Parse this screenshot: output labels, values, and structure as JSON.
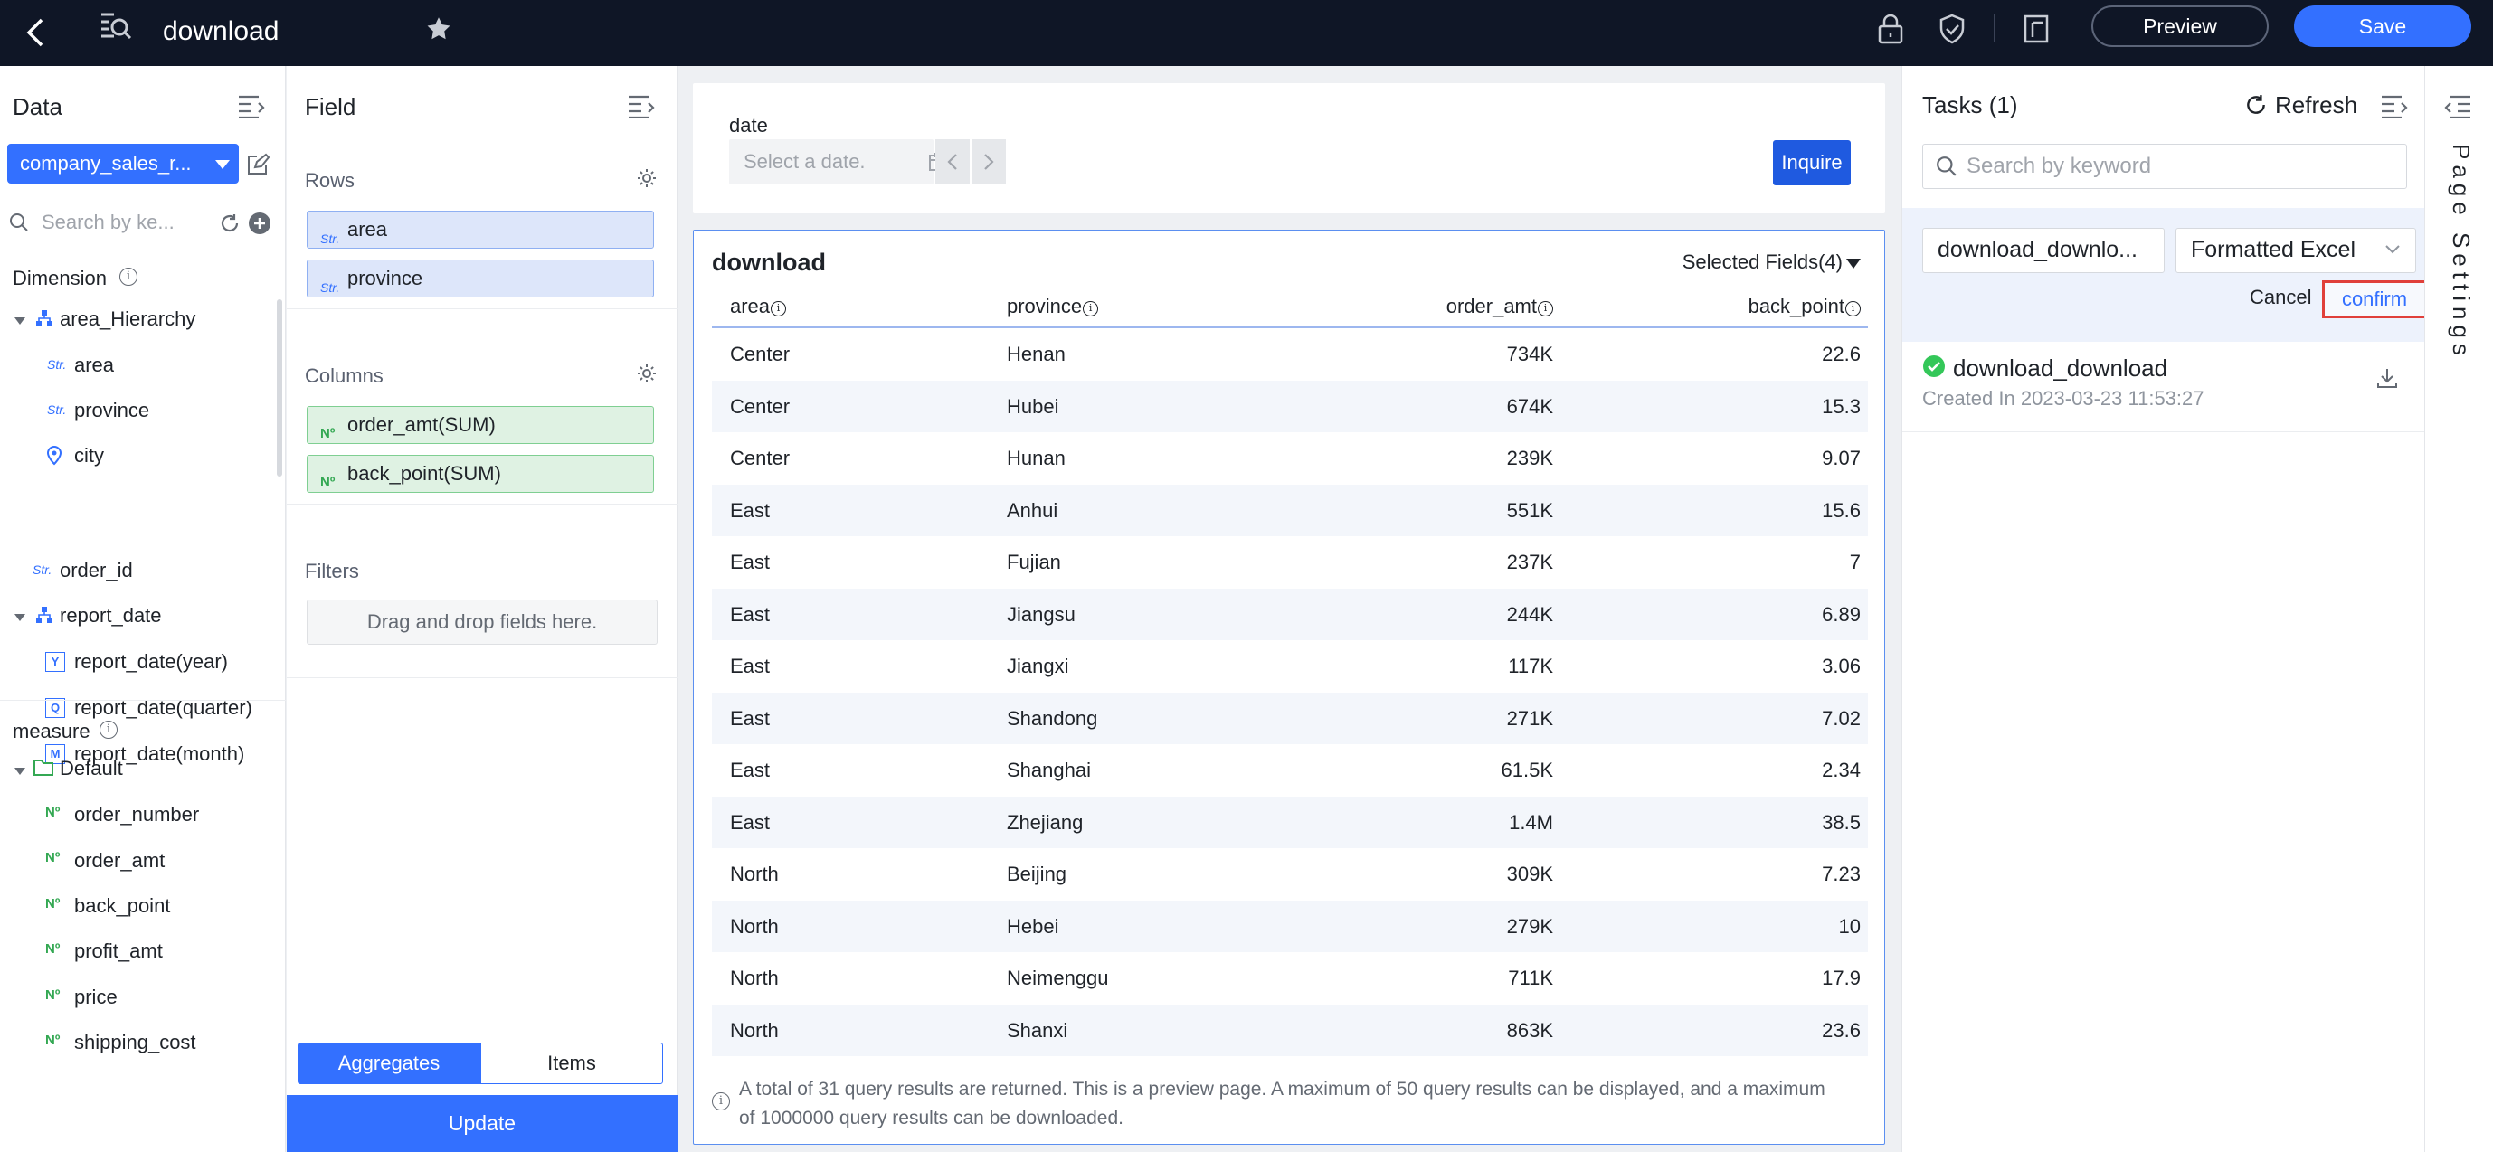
{
  "topbar": {
    "title": "download",
    "preview_label": "Preview",
    "save_label": "Save",
    "icons": [
      "back-icon",
      "dataset-search-icon",
      "star-icon",
      "lock-icon",
      "shield-check-icon",
      "copy-icon"
    ]
  },
  "data_panel": {
    "title": "Data",
    "dataset": "company_sales_r...",
    "search_placeholder": "Search by ke...",
    "dimension_label": "Dimension",
    "measure_label": "measure",
    "tree": {
      "area_hierarchy": "area_Hierarchy",
      "area": "area",
      "province": "province",
      "city": "city",
      "order_id": "order_id",
      "report_date": "report_date",
      "report_year": "report_date(year)",
      "report_quarter": "report_date(quarter)",
      "report_month": "report_date(month)",
      "default_folder": "Default",
      "measures": [
        "order_number",
        "order_amt",
        "back_point",
        "profit_amt",
        "price",
        "shipping_cost"
      ]
    },
    "tags": {
      "str": "Str.",
      "num": "Nº",
      "year": "Y",
      "quarter": "Q",
      "month": "M"
    }
  },
  "field_panel": {
    "title": "Field",
    "rows_label": "Rows",
    "rows": [
      "area",
      "province"
    ],
    "columns_label": "Columns",
    "columns": [
      "order_amt(SUM)",
      "back_point(SUM)"
    ],
    "filters_label": "Filters",
    "drop_hint": "Drag and drop fields here.",
    "aggregates_tab": "Aggregates",
    "items_tab": "Items",
    "update_label": "Update"
  },
  "filter": {
    "label": "date",
    "placeholder": "Select a date.",
    "inquire_label": "Inquire"
  },
  "table": {
    "title": "download",
    "selected_fields": "Selected Fields(4)",
    "headers": [
      "area",
      "province",
      "order_amt",
      "back_point"
    ],
    "rows": [
      [
        "Center",
        "Henan",
        "734K",
        "22.6"
      ],
      [
        "Center",
        "Hubei",
        "674K",
        "15.3"
      ],
      [
        "Center",
        "Hunan",
        "239K",
        "9.07"
      ],
      [
        "East",
        "Anhui",
        "551K",
        "15.6"
      ],
      [
        "East",
        "Fujian",
        "237K",
        "7"
      ],
      [
        "East",
        "Jiangsu",
        "244K",
        "6.89"
      ],
      [
        "East",
        "Jiangxi",
        "117K",
        "3.06"
      ],
      [
        "East",
        "Shandong",
        "271K",
        "7.02"
      ],
      [
        "East",
        "Shanghai",
        "61.5K",
        "2.34"
      ],
      [
        "East",
        "Zhejiang",
        "1.4M",
        "38.5"
      ],
      [
        "North",
        "Beijing",
        "309K",
        "7.23"
      ],
      [
        "North",
        "Hebei",
        "279K",
        "10"
      ],
      [
        "North",
        "Neimenggu",
        "711K",
        "17.9"
      ],
      [
        "North",
        "Shanxi",
        "863K",
        "23.6"
      ]
    ],
    "footnote": "A total of 31 query results are returned. This is a preview page. A maximum of 50 query results can be displayed, and a maximum of 1000000 query results can be downloaded."
  },
  "tasks": {
    "title": "Tasks",
    "count": "(1)",
    "refresh_label": "Refresh",
    "search_placeholder": "Search by keyword",
    "export_name": "download_downlo...",
    "export_format": "Formatted Excel",
    "cancel_label": "Cancel",
    "confirm_label": "confirm",
    "items": [
      {
        "name": "download_download",
        "created": "Created In 2023-03-23 11:53:27",
        "status": "success"
      }
    ]
  },
  "page_settings": {
    "label": "Page Settings"
  },
  "colors": {
    "accent": "#3370ff",
    "topbar": "#0f1626",
    "success": "#34c759",
    "highlight": "#e0403a"
  }
}
